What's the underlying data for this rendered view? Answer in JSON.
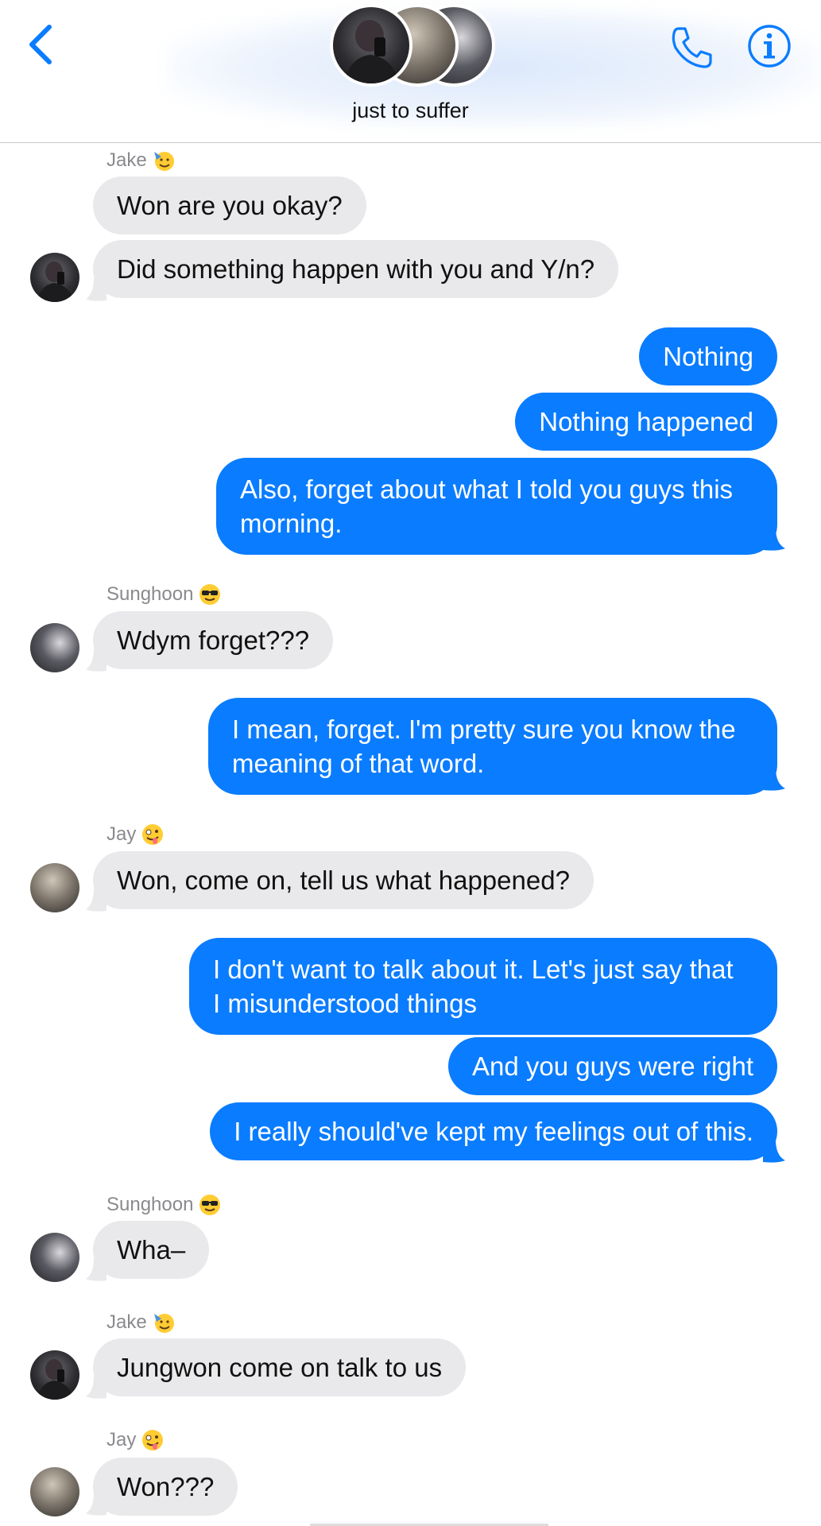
{
  "header": {
    "group_name": "just to suffer",
    "accent": "#0a7cff"
  },
  "messages": [
    {
      "sender": "Jake",
      "text": "Won are you okay?"
    },
    {
      "text": "Did something happen with you and Y/n?"
    },
    {
      "text": "Nothing"
    },
    {
      "text": "Nothing happened"
    },
    {
      "text_l1": "Also, forget about what I told you guys this",
      "text_l2": "morning."
    },
    {
      "sender": "Sunghoon",
      "text": "Wdym forget???"
    },
    {
      "text_l1": "I mean, forget. I'm pretty sure you know the",
      "text_l2": "meaning of that word."
    },
    {
      "sender": "Jay",
      "text": "Won, come on, tell us what happened?"
    },
    {
      "text_l1": "I don't want to talk about it. Let's just say that",
      "text_l2": "I misunderstood things"
    },
    {
      "text": "And you guys were right"
    },
    {
      "text": "I really should've kept my feelings out of this."
    },
    {
      "sender": "Sunghoon",
      "text": "Wha–"
    },
    {
      "sender": "Jake",
      "text": "Jungwon come on talk to us"
    },
    {
      "sender": "Jay",
      "text": "Won???"
    }
  ]
}
